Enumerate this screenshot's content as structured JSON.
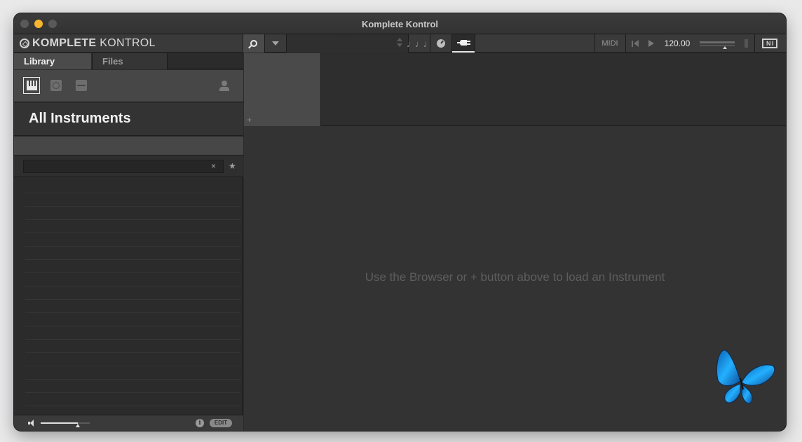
{
  "window": {
    "title": "Komplete Kontrol"
  },
  "brand": {
    "bold": "KOMPLETE",
    "light": "KONTROL"
  },
  "toolbar": {
    "midi_label": "MIDI",
    "bpm": "120.00"
  },
  "sidebar": {
    "tabs": [
      {
        "label": "Library"
      },
      {
        "label": "Files"
      }
    ],
    "heading": "All Instruments",
    "search": {
      "value": "",
      "placeholder": "",
      "clear": "×",
      "favorite": "★"
    },
    "footer": {
      "info_label": "i",
      "edit_label": "EDIT",
      "volume_fraction": 0.76
    }
  },
  "main": {
    "slot_plus": "+",
    "hint": "Use the Browser or + button above to load an Instrument"
  },
  "colors": {
    "accent_minimize": "#f5b52c",
    "butterfly_blue": "#1e9be8"
  }
}
